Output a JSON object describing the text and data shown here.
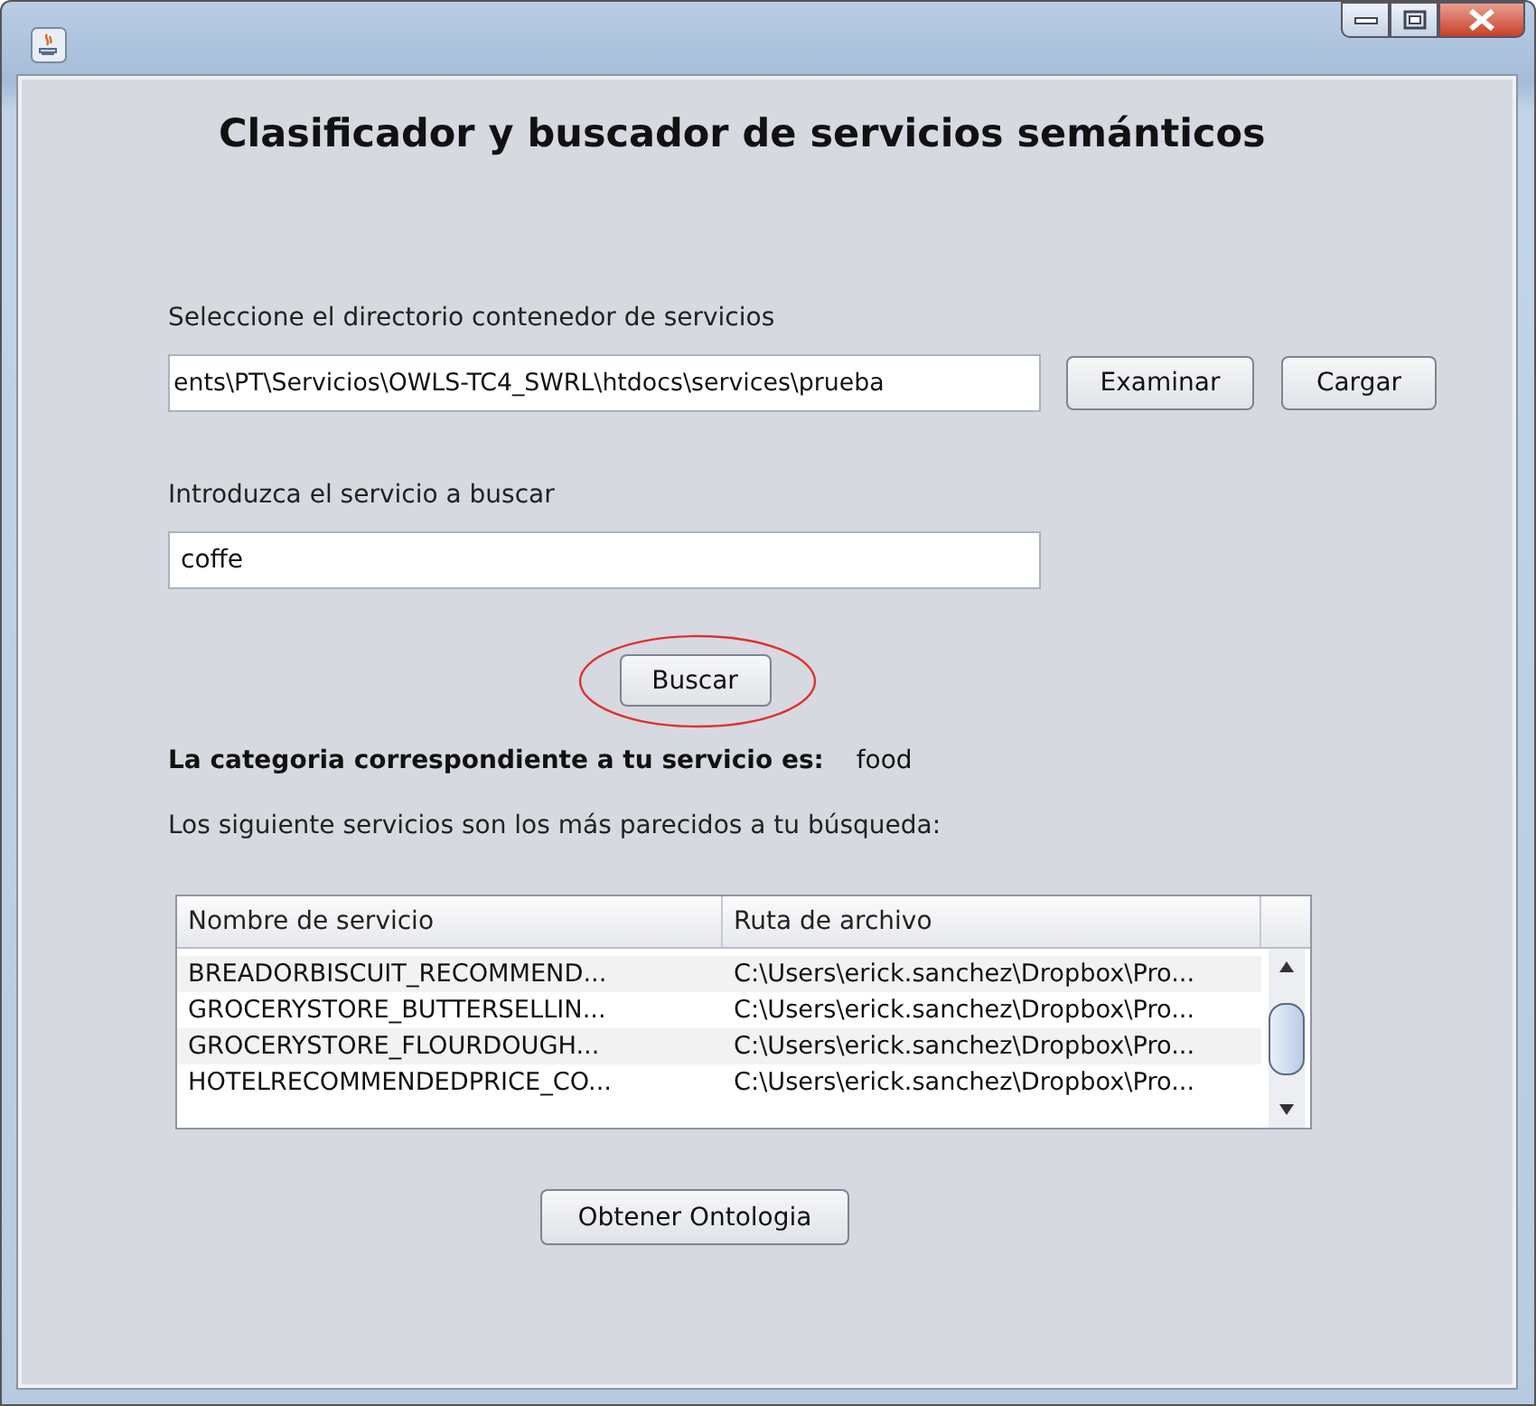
{
  "window": {
    "title": "Clasificador y buscador de servicios semánticos"
  },
  "directory": {
    "label": "Seleccione el directorio contenedor de servicios",
    "value": "ents\\PT\\Servicios\\OWLS-TC4_SWRL\\htdocs\\services\\prueba",
    "buttons": [
      "Examinar",
      "Cargar"
    ]
  },
  "search": {
    "label": "Introduzca el servicio a buscar",
    "value": "coffe",
    "button": "Buscar",
    "highlighted": true
  },
  "category": {
    "label": "La categoria correspondiente a tu servicio es:",
    "value": "food"
  },
  "results_label": "Los siguiente servicios son los más parecidos a tu búsqueda:",
  "table": {
    "columns": [
      "Nombre de servicio",
      "Ruta de archivo"
    ],
    "rows": [
      [
        "BREADORBISCUIT_RECOMMEND...",
        "C:\\Users\\erick.sanchez\\Dropbox\\Pro..."
      ],
      [
        "GROCERYSTORE_BUTTERSELLIN...",
        "C:\\Users\\erick.sanchez\\Dropbox\\Pro..."
      ],
      [
        "GROCERYSTORE_FLOURDOUGH...",
        "C:\\Users\\erick.sanchez\\Dropbox\\Pro..."
      ],
      [
        "HOTELRECOMMENDEDPRICE_CO...",
        "C:\\Users\\erick.sanchez\\Dropbox\\Pro..."
      ]
    ]
  },
  "ontology_button": "Obtener Ontologia"
}
